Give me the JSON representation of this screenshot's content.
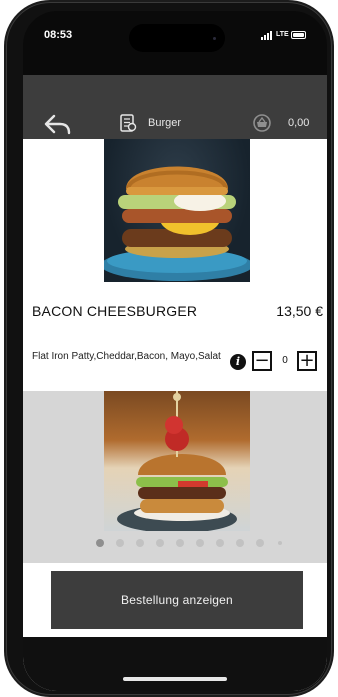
{
  "status_bar": {
    "time": "08:53",
    "network": "LTE"
  },
  "header": {
    "category": "Burger",
    "total": "0,00"
  },
  "product": {
    "name": "BACON CHEESBURGER",
    "price": "13,50 €",
    "description": "Flat Iron Patty,Cheddar,Bacon, Mayo,Salat",
    "quantity": "0",
    "minus_label": "−",
    "plus_label": "+",
    "info_label": "i"
  },
  "gallery": {
    "slide_count": 10,
    "active_index": 0
  },
  "footer": {
    "order_button": "Bestellung anzeigen"
  },
  "colors": {
    "header_bg": "#3d3d3d",
    "button_bg": "#3d3d3d",
    "gallery_bg": "#d6d6d6"
  },
  "icons": [
    "back-arrow-icon",
    "menu-book-icon",
    "basket-icon",
    "info-icon",
    "minus-icon",
    "plus-icon"
  ]
}
